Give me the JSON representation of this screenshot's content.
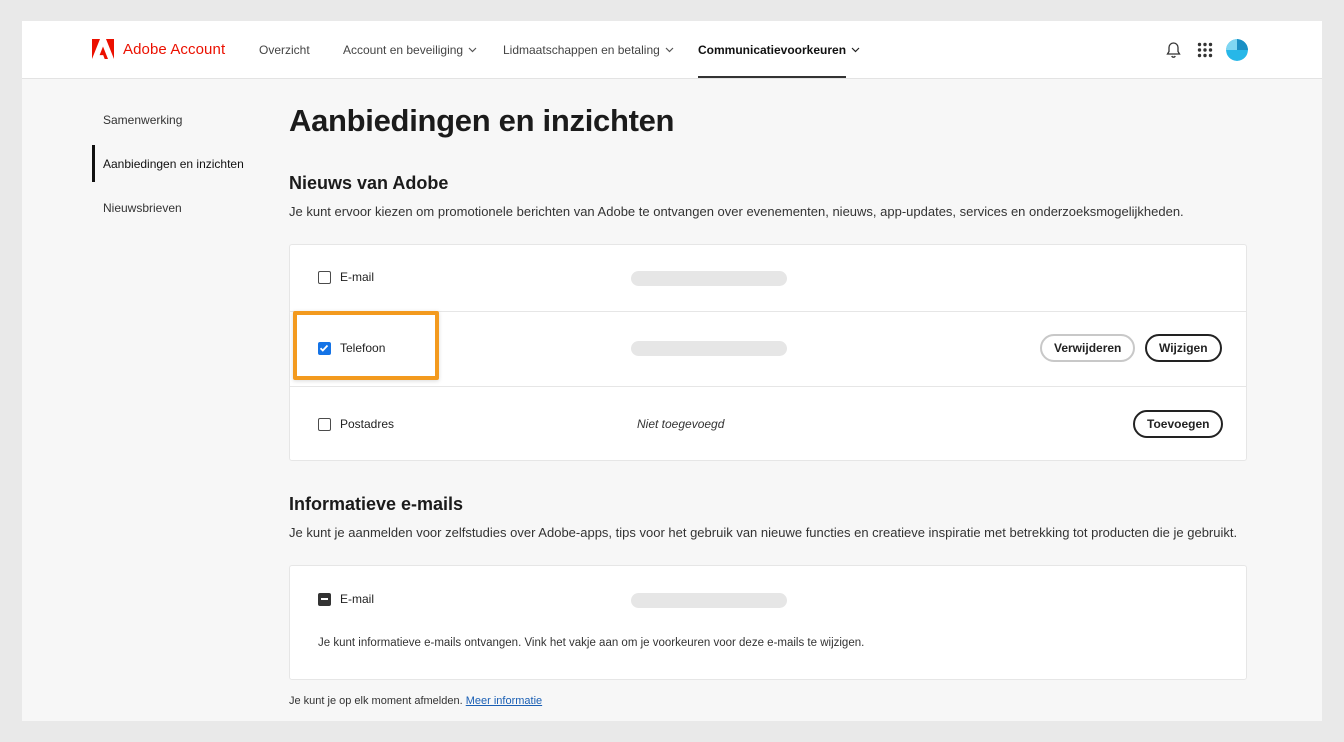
{
  "header": {
    "brand_name": "Adobe Account",
    "nav": [
      {
        "label": "Overzicht",
        "has_dropdown": false
      },
      {
        "label": "Account en beveiliging",
        "has_dropdown": true
      },
      {
        "label": "Lidmaatschappen en betaling",
        "has_dropdown": true
      },
      {
        "label": "Communicatievoorkeuren",
        "has_dropdown": true,
        "active": true
      }
    ],
    "icons": [
      "bell-icon",
      "app-grid-icon",
      "avatar"
    ]
  },
  "sidebar": {
    "items": [
      {
        "label": "Samenwerking",
        "active": false
      },
      {
        "label": "Aanbiedingen en inzichten",
        "active": true
      },
      {
        "label": "Nieuwsbrieven",
        "active": false
      }
    ]
  },
  "main": {
    "title": "Aanbiedingen en inzichten",
    "news": {
      "title": "Nieuws van Adobe",
      "description": "Je kunt ervoor kiezen om promotionele berichten van Adobe te ontvangen over evenementen, nieuws, app-updates, services en onderzoeksmogelijkheden.",
      "rows": [
        {
          "label": "E-mail",
          "checked": false
        },
        {
          "label": "Telefoon",
          "checked": true,
          "remove_label": "Verwijderen",
          "edit_label": "Wijzigen"
        },
        {
          "label": "Postadres",
          "checked": false,
          "status": "Niet toegevoegd",
          "add_label": "Toevoegen"
        }
      ]
    },
    "informative": {
      "title": "Informatieve e-mails",
      "description": "Je kunt je aanmelden voor zelfstudies over Adobe-apps, tips voor het gebruik van nieuwe functies en creatieve inspiratie met betrekking tot producten die je gebruikt.",
      "email_label": "E-mail",
      "email_state": "indeterminate",
      "info": "Je kunt informatieve e-mails ontvangen. Vink het vakje aan om je voorkeuren voor deze e-mails te wijzigen."
    },
    "footer": {
      "text": "Je kunt je op elk moment afmelden.",
      "link": "Meer informatie"
    }
  },
  "colors": {
    "brand_red": "#eb1000",
    "checkbox_blue": "#1473e6",
    "highlight_orange": "#f39a1e"
  }
}
